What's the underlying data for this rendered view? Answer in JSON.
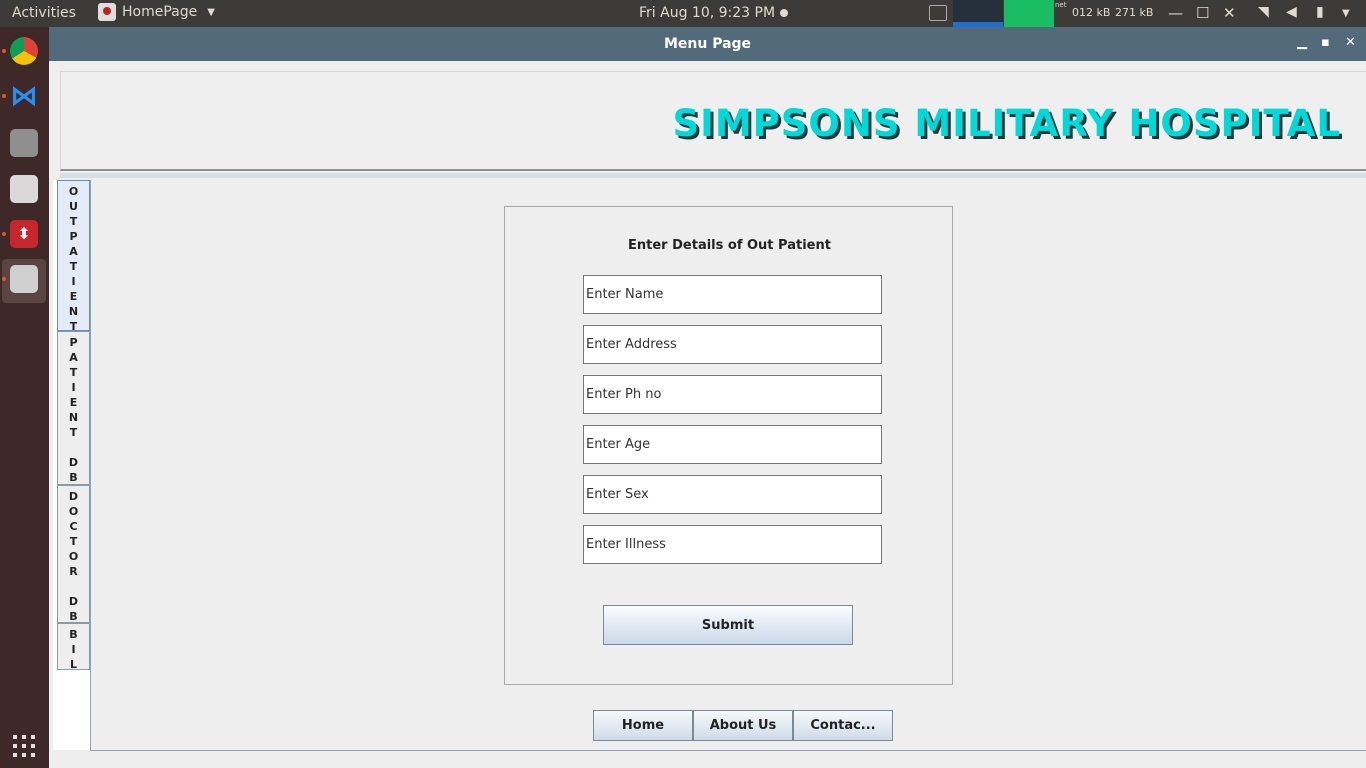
{
  "topbar": {
    "activities": "Activities",
    "app_name": "HomePage",
    "clock": "Fri Aug 10,  9:23 PM",
    "net_label": "net",
    "net_up": "012 kB",
    "net_down": "271 kB"
  },
  "launcher": {
    "items": [
      "chrome-icon",
      "vscode-icon",
      "files-icon",
      "software-center-icon",
      "app-icon",
      "java-icon",
      "show-apps-icon"
    ]
  },
  "window": {
    "title": "Menu Page",
    "hospital_name": "SIMPSONS MILITARY HOSPITAL",
    "accent_color": "#00d9d9"
  },
  "tabs": [
    {
      "label": "OUTPATIENT",
      "letters": [
        "O",
        "U",
        "T",
        "P",
        "A",
        "T",
        "I",
        "E",
        "N",
        "T"
      ],
      "selected": true
    },
    {
      "label": "PATIENT DB",
      "letters": [
        "P",
        "A",
        "T",
        "I",
        "E",
        "N",
        "T",
        " ",
        "D",
        "B"
      ],
      "selected": false
    },
    {
      "label": "DOCTOR DB",
      "letters": [
        "D",
        "O",
        "C",
        "T",
        "O",
        "R",
        " ",
        "D",
        "B"
      ],
      "selected": false
    },
    {
      "label": "BIL",
      "letters": [
        "B",
        "I",
        "L"
      ],
      "selected": false
    }
  ],
  "form": {
    "title": "Enter Details of Out Patient",
    "fields": [
      {
        "name": "name",
        "value": "Enter Name"
      },
      {
        "name": "address",
        "value": "Enter Address"
      },
      {
        "name": "phone",
        "value": "Enter Ph no"
      },
      {
        "name": "age",
        "value": "Enter Age"
      },
      {
        "name": "sex",
        "value": "Enter Sex"
      },
      {
        "name": "illness",
        "value": "Enter Illness"
      }
    ],
    "submit_label": "Submit"
  },
  "bottom_nav": {
    "home": "Home",
    "about": "About Us",
    "contact": "Contac..."
  }
}
